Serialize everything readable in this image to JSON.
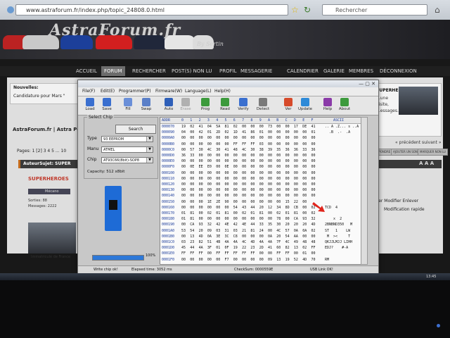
{
  "browser": {
    "url": "www.astraforum.fr/index.php/topic_24808.0.html",
    "search_placeholder": "Rechercher",
    "search_engine_glyph": "G"
  },
  "site": {
    "logo": "AstraForum.fr",
    "tagline": "By Sertin",
    "nav": [
      "ACCUEIL",
      "FORUM",
      "RECHERCHER",
      "POST(S) NON LU",
      "PROFIL",
      "MESSAGERIE",
      "CALENDRIER",
      "GALERIE",
      "MEMBRES",
      "DÉCONNEXION"
    ],
    "news_title": "Nouvelles:",
    "news_line": "Candidature pour Mars \"",
    "right_news_title": "SUPERHEROES,",
    "right_news_text": "...une visite, ...essages.",
    "page_title": "AstraForum.fr | Astra People",
    "pages_text": "Pages: 1 [2] 3 4 5 ... 10",
    "prev_subject": "« précédent suivant »",
    "right_buttons": [
      "RÉPONDRE",
      "AJOUTER UN SONDAGE",
      "MARQUER NON LU"
    ],
    "subject_bar": "AuteurSujet: SUPER",
    "aaa": "A A A",
    "user_name": "SUPERHEROES",
    "user_rank": "Mécano",
    "user_stats": [
      "Sorties: 88",
      "Messages: 2222"
    ],
    "user_foot": "Immatriculé de France",
    "post_actions": "Citer  Modifier  Enlever",
    "quick_reply": "Modification rapide"
  },
  "app": {
    "menus": [
      "File(F)",
      "Edit(E)",
      "Programmer(P)",
      "Firmware(W)",
      "Language(L)",
      "Help(H)"
    ],
    "toolbar": [
      {
        "label": "Load",
        "icon": "load-icon",
        "color": "#3a6fcf",
        "enabled": true
      },
      {
        "label": "Save",
        "icon": "save-icon",
        "color": "#3a6fcf",
        "enabled": true
      },
      {
        "label": "Fill",
        "icon": "fill-icon",
        "color": "#6a8fd8",
        "enabled": true
      },
      {
        "label": "Swap",
        "icon": "swap-icon",
        "color": "#5a7fc8",
        "enabled": true
      },
      {
        "label": "Auto",
        "icon": "auto-icon",
        "color": "#2e5fb8",
        "enabled": true
      },
      {
        "label": "Erase",
        "icon": "erase-icon",
        "color": "#b0b0b0",
        "enabled": false
      },
      {
        "label": "Prog",
        "icon": "prog-icon",
        "color": "#3c9a3c",
        "enabled": true
      },
      {
        "label": "Read",
        "icon": "read-icon",
        "color": "#3c9a3c",
        "enabled": true
      },
      {
        "label": "Verify",
        "icon": "verify-icon",
        "color": "#3a6fcf",
        "enabled": true
      },
      {
        "label": "Detect",
        "icon": "detect-icon",
        "color": "#7a7a7a",
        "enabled": true
      },
      {
        "label": "Ver",
        "icon": "version-icon",
        "color": "#d64a2a",
        "enabled": true
      },
      {
        "label": "Update",
        "icon": "update-icon",
        "color": "#2e8ad8",
        "enabled": true
      },
      {
        "label": "Help",
        "icon": "help-icon",
        "color": "#8a3aa8",
        "enabled": true
      },
      {
        "label": "About",
        "icon": "about-icon",
        "color": "#3c9a3c",
        "enabled": true
      }
    ],
    "chip_group_label": "Select Chip",
    "search_button": "Search",
    "type_label": "Type",
    "type_value": "93 EEPROM",
    "manu_label": "Manu",
    "manu_value": "ATMEL",
    "chip_label": "Chip",
    "chip_value": "AT93C66(8bit)-SOP8",
    "capacity": "Capacity: 512 x8bit",
    "progress": 1.0,
    "progress_text": "100%",
    "hex_header_addr": "ADDR",
    "hex_columns": [
      "0",
      "1",
      "2",
      "3",
      "4",
      "5",
      "6",
      "7",
      "8",
      "9",
      "A",
      "B",
      "C",
      "D",
      "E",
      "F"
    ],
    "hex_ascii_header": "ASCII",
    "hex_rows": [
      {
        "addr": "000070",
        "bytes": "19 02 41 04 5A 81 02 00 00 00 73 00 00 17 DE 41",
        "ascii": ".. A .Z... s ..A"
      },
      {
        "addr": "000090",
        "bytes": "04 00 42 01 2D 02 1D 41 86 01 00 00 00 00 00 01",
        "ascii": "  .B  .-  .A"
      },
      {
        "addr": "0000A0",
        "bytes": "00 00 00 00 00 00 00 00 00 00 00 00 00 00 00 00",
        "ascii": ""
      },
      {
        "addr": "0000B0",
        "bytes": "00 00 00 00 00 00 FF FF FF 03 00 00 00 00 00 00",
        "ascii": ""
      },
      {
        "addr": "0000C0",
        "bytes": "00 57 30 4C 30 41 48 4C 30 38 39 35 36 36 33 36",
        "ascii": ""
      },
      {
        "addr": "0000D0",
        "bytes": "36 33 00 00 00 00 00 00 00 00 00 00 00 00 00 00",
        "ascii": ""
      },
      {
        "addr": "0000E0",
        "bytes": "00 00 00 00 00 00 00 00 00 00 00 00 00 00 00 00",
        "ascii": ""
      },
      {
        "addr": "0000F0",
        "bytes": "00 0E EE E0 00 0E 00 00 00 00 00 00 00 00 00 00",
        "ascii": ""
      },
      {
        "addr": "000100",
        "bytes": "00 00 00 00 00 00 00 00 00 00 00 00 00 00 00 00",
        "ascii": ""
      },
      {
        "addr": "000110",
        "bytes": "00 00 00 00 00 00 00 00 00 00 00 00 00 00 00 00",
        "ascii": ""
      },
      {
        "addr": "000120",
        "bytes": "00 00 00 00 00 00 00 00 00 00 00 00 00 00 00 00",
        "ascii": ""
      },
      {
        "addr": "000130",
        "bytes": "00 00 00 00 00 00 00 00 00 00 00 00 00 00 00 00",
        "ascii": ""
      },
      {
        "addr": "000140",
        "bytes": "00 00 00 00 00 00 00 00 00 00 00 00 00 00 00 00",
        "ascii": ""
      },
      {
        "addr": "000150",
        "bytes": "00 00 00 1E 2E 90 00 00 00 00 00 00 15 22 00",
        "ascii": ""
      },
      {
        "addr": "000160",
        "bytes": "00 00 00 00 00 00 54 43 44 20 12 34 8D CB 00 02",
        "ascii": "TCD  4"
      },
      {
        "addr": "000170",
        "bytes": "01 81 00 02 01 81 00 02 01 81 00 02 01 81 00 02",
        "ascii": ""
      },
      {
        "addr": "000180",
        "bytes": "01 81 00 00 00 00 00 00 00 00 00 78 00 CA 93 32",
        "ascii": "    x  2"
      },
      {
        "addr": "000190",
        "bytes": "00 CA 93 32 42 4E 42 4E 44 33 35 30 20 20 20 4D",
        "ascii": "2BNBND350   M"
      },
      {
        "addr": "0001A0",
        "bytes": "53 54 20 09 03 31 03 21 81 24 00 4C 57 0A 0A 02",
        "ascii": "ST   1    LW"
      },
      {
        "addr": "0001B0",
        "bytes": "00 13 4D 0A 3E 3C C8 00 00 00 0A 20 54 AA 00 00",
        "ascii": " M  ><     T"
      },
      {
        "addr": "0001C0",
        "bytes": "03 23 82 51 4B 4A 4A 4C 4D 4A 4A 7F 4C 49 48 48",
        "ascii": "QKJJLMJJ LIHH"
      },
      {
        "addr": "0001D0",
        "bytes": "45 44 4A 3F 01 0F 19 22 23 2D 41 60 82 13 02 FF",
        "ascii": "EDJ?    #-A"
      },
      {
        "addr": "0001E0",
        "bytes": "FF FF FF 00 FF FF FF FF FF 00 00 FF FF 00 01 00",
        "ascii": ""
      },
      {
        "addr": "0001F0",
        "bytes": "00 00 00 00 00 F7 00 00 00 00 09 13 19 52 4D 70",
        "ascii": "RM"
      }
    ],
    "status": {
      "left": "Write chip ok!",
      "elapsed": "Elapsed time: 3052 ms",
      "checksum": "CheckSum: 0000559E",
      "usb": "USB Link OK!"
    }
  },
  "taskbar": {
    "time": "13:45"
  },
  "colors": {
    "accent_red": "#e0241b",
    "progress_blue": "#2d78d8"
  }
}
